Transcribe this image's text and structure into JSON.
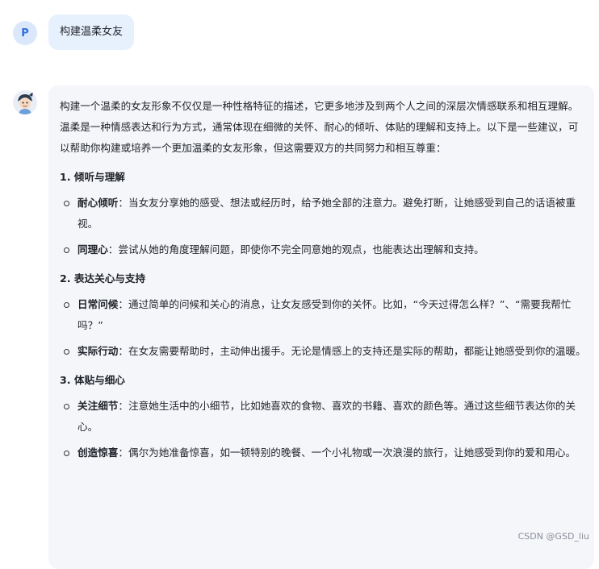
{
  "user": {
    "avatar_letter": "P",
    "message": "构建温柔女友"
  },
  "assistant": {
    "intro": "构建一个温柔的女友形象不仅仅是一种性格特征的描述，它更多地涉及到两个人之间的深层次情感联系和相互理解。温柔是一种情感表达和行为方式，通常体现在细微的关怀、耐心的倾听、体贴的理解和支持上。以下是一些建议，可以帮助你构建或培养一个更加温柔的女友形象，但这需要双方的共同努力和相互尊重：",
    "sections": [
      {
        "title": "1. 倾听与理解",
        "items": [
          {
            "term": "耐心倾听",
            "text": "：当女友分享她的感受、想法或经历时，给予她全部的注意力。避免打断，让她感受到自己的话语被重视。"
          },
          {
            "term": "同理心",
            "text": "：尝试从她的角度理解问题，即使你不完全同意她的观点，也能表达出理解和支持。"
          }
        ]
      },
      {
        "title": "2. 表达关心与支持",
        "items": [
          {
            "term": "日常问候",
            "text": "：通过简单的问候和关心的消息，让女友感受到你的关怀。比如，“今天过得怎么样？”、“需要我帮忙吗？”"
          },
          {
            "term": "实际行动",
            "text": "：在女友需要帮助时，主动伸出援手。无论是情感上的支持还是实际的帮助，都能让她感受到你的温暖。"
          }
        ]
      },
      {
        "title": "3. 体贴与细心",
        "items": [
          {
            "term": "关注细节",
            "text": "：注意她生活中的小细节，比如她喜欢的食物、喜欢的书籍、喜欢的颜色等。通过这些细节表达你的关心。"
          },
          {
            "term": "创造惊喜",
            "text": "：偶尔为她准备惊喜，如一顿特别的晚餐、一个小礼物或一次浪漫的旅行，让她感受到你的爱和用心。"
          }
        ]
      }
    ]
  },
  "watermark": "CSDN @GSD_liu"
}
